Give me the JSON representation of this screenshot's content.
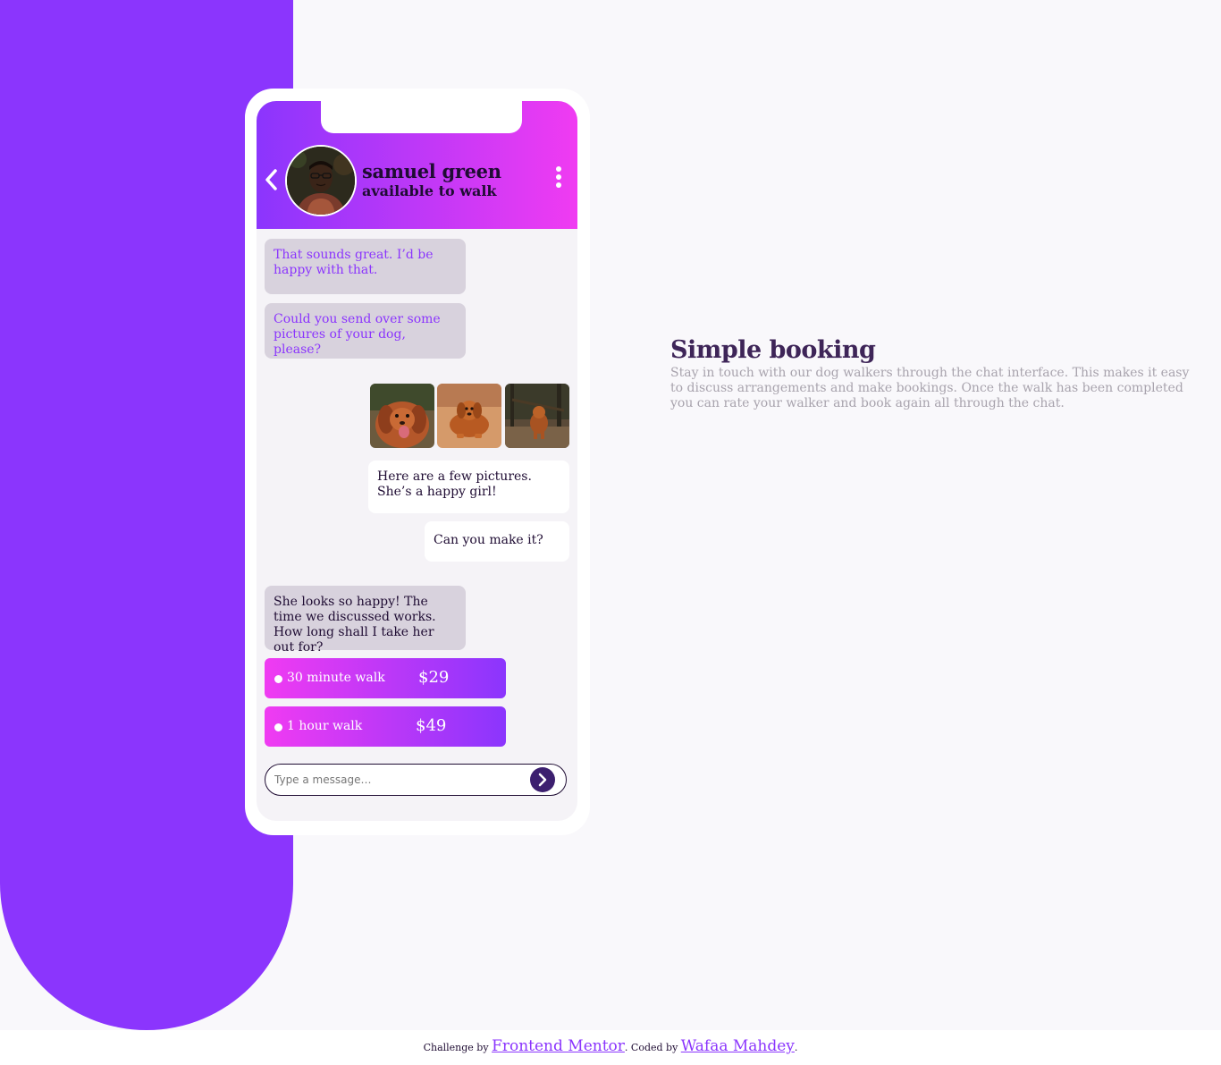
{
  "contact": {
    "name": "samuel green",
    "status": "available to walk"
  },
  "messages": [
    {
      "from": "walker",
      "text": "That sounds great. I’d be happy with that."
    },
    {
      "from": "walker",
      "text": "Could you send over some pictures of your dog, please?"
    },
    {
      "from": "owner",
      "text": "Here are a few pictures. She’s a happy girl!"
    },
    {
      "from": "owner",
      "text": "Can you make it?"
    },
    {
      "from": "walker",
      "text": "She looks so happy! The time we discussed works. How long shall I take her out for?"
    }
  ],
  "offers": [
    {
      "label": "30 minute walk",
      "price": "$29"
    },
    {
      "label": "1 hour walk",
      "price": "$49"
    }
  ],
  "composer": {
    "placeholder": "Type a message…"
  },
  "feature": {
    "title": "Simple booking",
    "description": "Stay in touch with our dog walkers through the chat interface. This makes it easy to discuss arrangements and make bookings. Once the walk has been completed you can rate your walker and book again all through the chat."
  },
  "footer": {
    "challenge_prefix": "Challenge by ",
    "challenge_link": "Frontend Mentor",
    "coded_prefix": ". Coded by ",
    "coded_link": "Wafaa Mahdey",
    "suffix": "."
  },
  "colors": {
    "primary_violet": "#8b35fd",
    "magenta": "#f03bf2",
    "dark_violet": "#3c1f6f",
    "grayish_blue_text": "#a8a3ad"
  },
  "icons": [
    "chevron-left-icon",
    "more-vertical-icon",
    "chevron-right-icon"
  ]
}
